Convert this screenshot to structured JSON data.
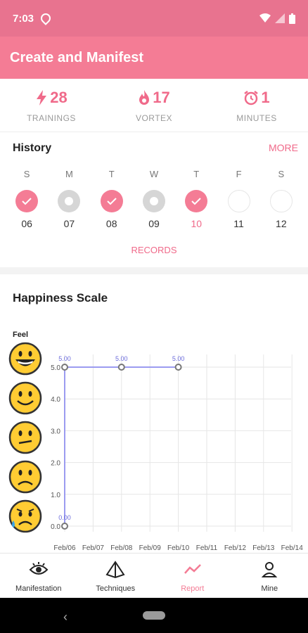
{
  "status_bar": {
    "time": "7:03"
  },
  "app_bar": {
    "title": "Create and Manifest"
  },
  "stats": [
    {
      "value": "28",
      "label": "TRAININGS",
      "icon": "lightning-icon"
    },
    {
      "value": "17",
      "label": "VORTEX",
      "icon": "flame-icon"
    },
    {
      "value": "1",
      "label": "MINUTES",
      "icon": "alarm-clock-icon"
    }
  ],
  "history": {
    "title": "History",
    "more_label": "MORE",
    "records_label": "RECORDS",
    "days": [
      {
        "dow": "S",
        "date": "06",
        "state": "done"
      },
      {
        "dow": "M",
        "date": "07",
        "state": "grey"
      },
      {
        "dow": "T",
        "date": "08",
        "state": "done"
      },
      {
        "dow": "W",
        "date": "09",
        "state": "grey"
      },
      {
        "dow": "T",
        "date": "10",
        "state": "done"
      },
      {
        "dow": "F",
        "date": "11",
        "state": "empty"
      },
      {
        "dow": "S",
        "date": "12",
        "state": "empty"
      }
    ]
  },
  "happiness": {
    "title": "Happiness Scale",
    "feel_label": "Feel",
    "faces": [
      "grinning-face-icon",
      "smiling-face-icon",
      "neutral-face-icon",
      "frowning-face-icon",
      "sad-sweat-face-icon"
    ]
  },
  "chart_data": {
    "type": "line",
    "categories": [
      "Feb/06",
      "Feb/07",
      "Feb/08",
      "Feb/09",
      "Feb/10",
      "Feb/11",
      "Feb/12",
      "Feb/13",
      "Feb/14"
    ],
    "series": [
      {
        "points": [
          [
            "Feb/06",
            0.0
          ],
          [
            "Feb/06",
            5.0
          ],
          [
            "Feb/08",
            5.0
          ],
          [
            "Feb/10",
            5.0
          ]
        ],
        "point_labels": [
          "0.00",
          "5.00",
          "5.00",
          "5.00"
        ]
      }
    ],
    "yticks": [
      "0.0",
      "1.0",
      "2.0",
      "3.0",
      "4.0",
      "5.0"
    ],
    "ylim": [
      0,
      5
    ],
    "grid": true,
    "line_color": "#9b9bf0"
  },
  "bottom_nav": [
    {
      "label": "Manifestation",
      "icon": "eye-icon",
      "active": false
    },
    {
      "label": "Techniques",
      "icon": "pyramid-icon",
      "active": false
    },
    {
      "label": "Report",
      "icon": "line-chart-icon",
      "active": true
    },
    {
      "label": "Mine",
      "icon": "person-icon",
      "active": false
    }
  ],
  "colors": {
    "accent": "#f47c95",
    "status_bar": "#e8738f"
  }
}
